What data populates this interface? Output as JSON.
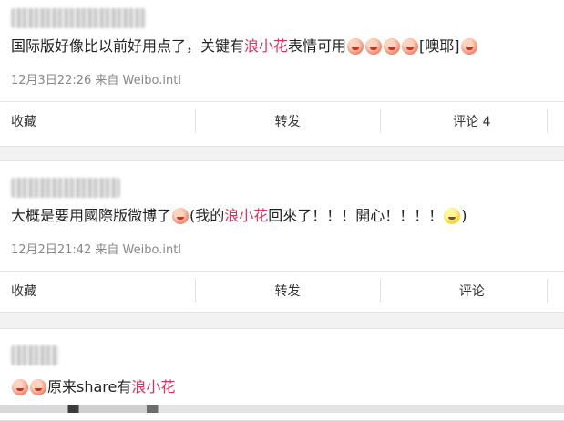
{
  "posts": [
    {
      "text_parts": [
        "国际版好像比以前好用点了，关键有",
        "浪小花",
        "表情可用",
        "[噢耶]"
      ],
      "time": "12月3日22:26",
      "source": "来自 Weibo.intl",
      "actions": [
        "收藏",
        "转发",
        "评论 4"
      ]
    },
    {
      "text_parts": [
        "大概是要用國際版微博了",
        "(我的",
        "浪小花",
        "回來了！！！開心！！！！",
        ")"
      ],
      "time": "12月2日21:42",
      "source": "来自 Weibo.intl",
      "actions": [
        "收藏",
        "转发",
        "评论"
      ]
    },
    {
      "text_parts": [
        "原来share有",
        "浪小花"
      ]
    }
  ],
  "colors": {
    "highlight": "#e0305a",
    "meta": "#888888",
    "background": "#f2f2f2"
  },
  "icons": [
    "emoticon-icon",
    "smiley-icon"
  ]
}
